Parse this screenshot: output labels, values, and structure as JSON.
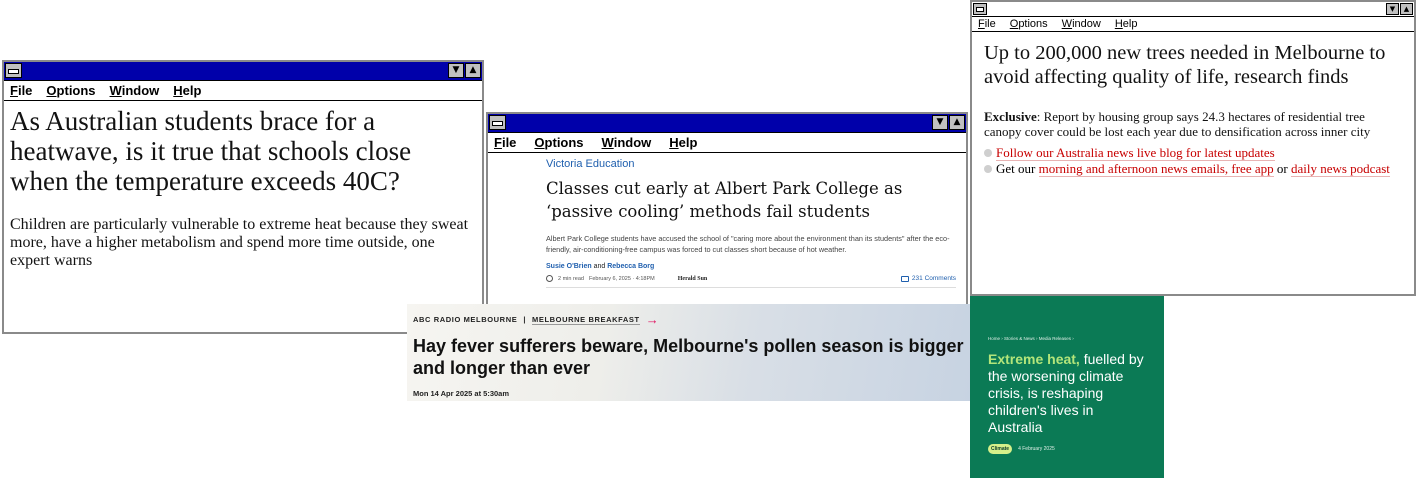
{
  "menu": [
    "File",
    "Options",
    "Window",
    "Help"
  ],
  "window1": {
    "headline": "As Australian students brace for a heatwave, is it true that schools close when the temperature exceeds 40C?",
    "standfirst": "Children are particularly vulnerable to extreme heat because they sweat more, have a higher metabolism and spend more time outside, one expert warns"
  },
  "window2": {
    "section": "Victoria Education",
    "headline": "Classes cut early at Albert Park College as ‘passive cooling’ methods fail students",
    "summary": "Albert Park College students have accused the school of \"caring more about the environment than its students\" after the eco-friendly, air-conditioning-free campus was forced to cut classes short because of hot weather.",
    "author1": "Susie O'Brien",
    "and": "and",
    "author2": "Rebecca Borg",
    "read_time": "2 min read",
    "date": "February 6, 2025 · 4:18PM",
    "brand": "Herald Sun",
    "comments": "231 Comments"
  },
  "window3": {
    "headline": "Up to 200,000 new trees needed in Melbourne to avoid affecting quality of life, research finds",
    "exclusive": "Exclusive",
    "summary": ": Report by housing group says 24.3 hectares of residential tree canopy cover could be lost each year due to densification across inner city",
    "bullet1": "Follow our Australia news live blog for latest updates",
    "bullet2_pre": "Get our ",
    "bullet2_link1": "morning and afternoon news emails, free app",
    "bullet2_mid": " or ",
    "bullet2_link2": "daily news podcast"
  },
  "abc": {
    "crumb1": "ABC RADIO MELBOURNE",
    "sep": "|",
    "crumb2": "MELBOURNE BREAKFAST",
    "arrow": "→",
    "headline": "Hay fever sufferers beware, Melbourne's pollen season is bigger and longer than ever",
    "date": "Mon 14 Apr 2025 at 5:30am"
  },
  "green": {
    "crumb": "Home  ›  Stories & News  ›  Media Releases  ›",
    "highlight": "Extreme heat,",
    "headline_rest": " fuelled by the worsening climate crisis, is reshaping children's lives in Australia",
    "tag": "Climate",
    "date": "4 February 2025"
  }
}
